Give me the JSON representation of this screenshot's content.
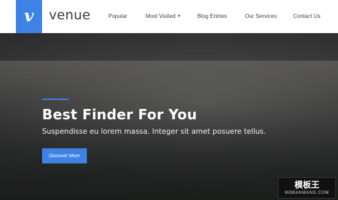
{
  "brand": {
    "logo_letter": "v",
    "name": "venue",
    "accent_color": "#3f82e6"
  },
  "nav": {
    "items": [
      {
        "label": "Popular"
      },
      {
        "label": "Most Visited",
        "dropdown": true
      },
      {
        "label": "Blog Entries"
      },
      {
        "label": "Our Services"
      },
      {
        "label": "Contact Us"
      }
    ]
  },
  "hero": {
    "title": "Best Finder For You",
    "subtitle": "Suspendisse eu lorem massa. Integer sit amet posuere tellus.",
    "cta_label": "Discover More"
  },
  "watermark": {
    "title": "模板王",
    "url": "MOBANWANG.COM"
  }
}
